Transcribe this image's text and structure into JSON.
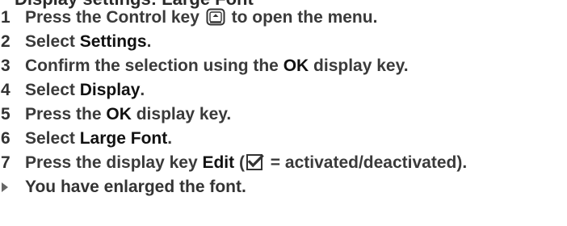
{
  "header": "Display settings: Large Font",
  "steps": [
    {
      "num": "1",
      "before": "Press the Control key",
      "icon": "control-key-icon",
      "after": "to open the menu."
    },
    {
      "num": "2",
      "before": "Select ",
      "bold": "Settings",
      "after": "."
    },
    {
      "num": "3",
      "before": "Confirm the selection using the ",
      "bold": "OK",
      "after": " display key."
    },
    {
      "num": "4",
      "before": "Select ",
      "bold": "Display",
      "after": "."
    },
    {
      "num": "5",
      "before": "Press the ",
      "bold": "OK",
      "after": " display key."
    },
    {
      "num": "6",
      "before": "Select ",
      "bold": "Large Font",
      "after": "."
    },
    {
      "num": "7",
      "before": "Press the display key ",
      "bold": "Edit",
      "paren_open": " (",
      "icon": "checkbox-checked-icon",
      "after": " = activated/deactivated)."
    }
  ],
  "result": "You have enlarged the font.",
  "colors": {
    "text": "#333333",
    "emphasis": "#111111",
    "arrow": "#666666"
  }
}
